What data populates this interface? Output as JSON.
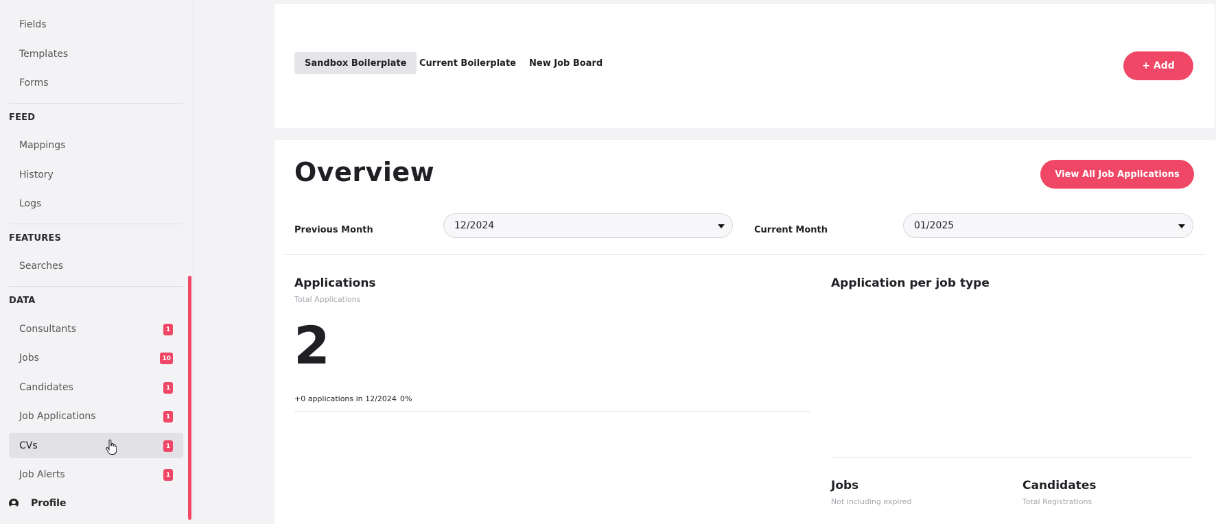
{
  "sidebar": {
    "items_top": [
      {
        "label": "Fields"
      },
      {
        "label": "Templates"
      },
      {
        "label": "Forms"
      }
    ],
    "feed": {
      "title": "FEED",
      "items": [
        {
          "label": "Mappings"
        },
        {
          "label": "History"
        },
        {
          "label": "Logs"
        }
      ]
    },
    "features": {
      "title": "FEATURES",
      "items": [
        {
          "label": "Searches"
        }
      ]
    },
    "data": {
      "title": "DATA",
      "items": [
        {
          "label": "Consultants",
          "badge": "1"
        },
        {
          "label": "Jobs",
          "badge": "10"
        },
        {
          "label": "Candidates",
          "badge": "1"
        },
        {
          "label": "Job Applications",
          "badge": "1"
        },
        {
          "label": "CVs",
          "badge": "1",
          "active": true
        },
        {
          "label": "Job Alerts",
          "badge": "1"
        }
      ]
    },
    "profile": {
      "label": "Profile",
      "icon": "user-circle-icon"
    },
    "accent_color": "#ef4765"
  },
  "tabs": [
    {
      "label": "Sandbox Boilerplate",
      "active": true
    },
    {
      "label": "Current Boilerplate"
    },
    {
      "label": "New Job Board"
    }
  ],
  "add_button": {
    "label": "+ Add"
  },
  "overview": {
    "title": "Overview",
    "view_all_button": "View All Job Applications",
    "previous_month": {
      "label": "Previous Month",
      "value": "12/2024"
    },
    "current_month": {
      "label": "Current Month",
      "value": "01/2025"
    }
  },
  "applications": {
    "title": "Applications",
    "subtitle": "Total Applications",
    "value": "2",
    "delta_text": "+0 applications in 12/2024",
    "delta_percent": "0%"
  },
  "per_job_type": {
    "title": "Application per job type"
  },
  "jobs": {
    "title": "Jobs",
    "subtitle": "Not including expired"
  },
  "candidates": {
    "title": "Candidates",
    "subtitle": "Total Registrations"
  }
}
